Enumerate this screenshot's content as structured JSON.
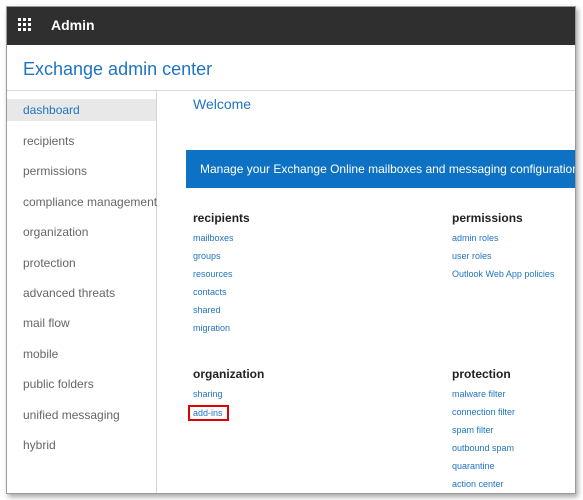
{
  "topbar": {
    "title": "Admin",
    "icon": "app-launcher-icon"
  },
  "app": {
    "title": "Exchange admin center"
  },
  "sidebar": {
    "items": [
      {
        "label": "dashboard",
        "active": true
      },
      {
        "label": "recipients",
        "active": false
      },
      {
        "label": "permissions",
        "active": false
      },
      {
        "label": "compliance management",
        "active": false
      },
      {
        "label": "organization",
        "active": false
      },
      {
        "label": "protection",
        "active": false
      },
      {
        "label": "advanced threats",
        "active": false
      },
      {
        "label": "mail flow",
        "active": false
      },
      {
        "label": "mobile",
        "active": false
      },
      {
        "label": "public folders",
        "active": false
      },
      {
        "label": "unified messaging",
        "active": false
      },
      {
        "label": "hybrid",
        "active": false
      }
    ]
  },
  "main": {
    "welcome": "Welcome",
    "banner": "Manage your Exchange Online mailboxes and messaging configurations in",
    "sections": {
      "recipients": {
        "heading": "recipients",
        "links": [
          "mailboxes",
          "groups",
          "resources",
          "contacts",
          "shared",
          "migration"
        ]
      },
      "permissions": {
        "heading": "permissions",
        "links": [
          "admin roles",
          "user roles",
          "Outlook Web App policies"
        ]
      },
      "organization": {
        "heading": "organization",
        "links": [
          "sharing",
          "add-ins"
        ]
      },
      "protection": {
        "heading": "protection",
        "links": [
          "malware filter",
          "connection filter",
          "spam filter",
          "outbound spam",
          "quarantine",
          "action center"
        ]
      }
    }
  },
  "colors": {
    "topbar": "#2f2f2f",
    "accent": "#1f74c2",
    "banner": "#0e72c4",
    "highlight": "#e00000"
  }
}
